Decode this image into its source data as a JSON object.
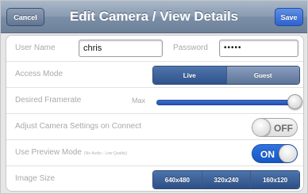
{
  "header": {
    "title": "Edit Camera / View Details",
    "cancel_label": "Cancel",
    "save_label": "Save"
  },
  "colors": {
    "nav_bar": "#7f92ab",
    "accent_blue": "#2d61d3",
    "label_gray": "#a9a9a9"
  },
  "credentials": {
    "user_label": "User Name",
    "user_value": "chris",
    "password_label": "Password",
    "password_value": "•••••"
  },
  "access_mode": {
    "label": "Access Mode",
    "options": [
      "Live",
      "Guest"
    ],
    "selected": "Live"
  },
  "framerate": {
    "label": "Desired Framerate",
    "value_label": "Max",
    "level": 1.0
  },
  "adjust_settings": {
    "label": "Adjust Camera Settings on Connect",
    "state": "OFF"
  },
  "preview_mode": {
    "label": "Use Preview Mode",
    "note": "(No Audio - Low Quality)",
    "state": "ON"
  },
  "image_size": {
    "label": "Image Size",
    "options": [
      "640x480",
      "320x240",
      "160x120"
    ]
  }
}
